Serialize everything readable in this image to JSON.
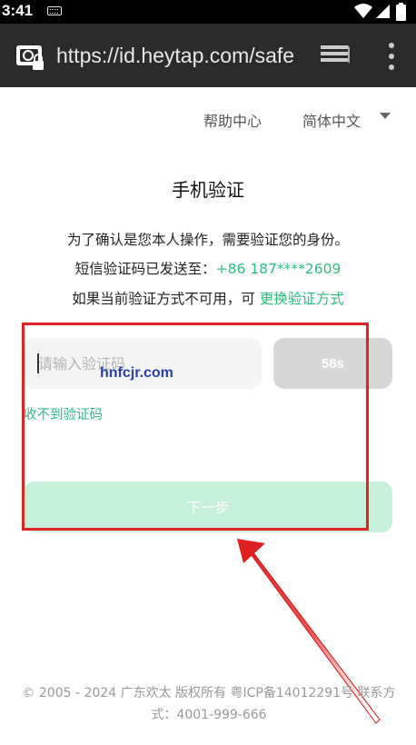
{
  "status_bar": {
    "time": "3:41"
  },
  "browser": {
    "url": "https://id.heytap.com/safe"
  },
  "top_links": {
    "help": "帮助中心",
    "language": "简体中文"
  },
  "page": {
    "title": "手机验证",
    "line1": "为了确认是您本人操作，需要验证您的身份。",
    "sent_prefix": "短信验证码已发送至：",
    "phone": "+86 187****2609",
    "unavailable_prefix": "如果当前验证方式不可用，可",
    "change_method": "更换验证方式"
  },
  "form": {
    "code_placeholder": "请输入验证码",
    "resend_countdown": "58s",
    "no_code": "收不到验证码",
    "next": "下一步"
  },
  "watermark": "hnfcjr.com",
  "footer": {
    "text": "© 2005 - 2024 广东欢太 版权所有 粤ICP备14012291号 联系方式：4001-999-666"
  },
  "colors": {
    "accent": "#2bbf7b",
    "next_button_disabled": "#c6f0da",
    "highlight": "#e02424"
  }
}
